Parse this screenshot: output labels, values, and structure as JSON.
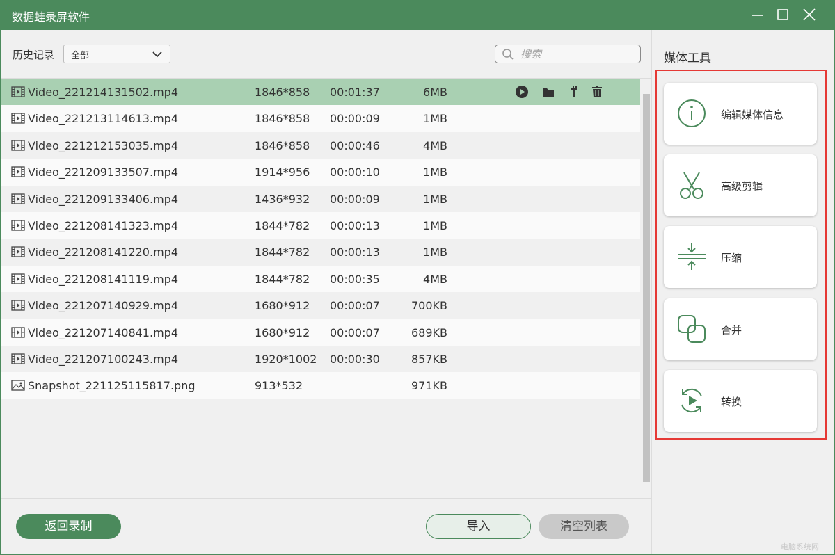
{
  "app": {
    "title": "数据蛙录屏软件"
  },
  "colors": {
    "brand": "#4b8a5c",
    "selected_row": "#a9d0b2",
    "highlight_border": "#e53935"
  },
  "toolbar": {
    "history_label": "历史记录",
    "filter_value": "全部",
    "search_placeholder": "搜索"
  },
  "files": [
    {
      "name": "Video_221214131502.mp4",
      "resolution": "1846*858",
      "duration": "00:01:37",
      "size": "6MB",
      "type": "video",
      "selected": true
    },
    {
      "name": "Video_221213114613.mp4",
      "resolution": "1846*858",
      "duration": "00:00:09",
      "size": "1MB",
      "type": "video"
    },
    {
      "name": "Video_221212153035.mp4",
      "resolution": "1846*858",
      "duration": "00:00:46",
      "size": "4MB",
      "type": "video"
    },
    {
      "name": "Video_221209133507.mp4",
      "resolution": "1914*956",
      "duration": "00:00:10",
      "size": "1MB",
      "type": "video"
    },
    {
      "name": "Video_221209133406.mp4",
      "resolution": "1436*932",
      "duration": "00:00:09",
      "size": "1MB",
      "type": "video"
    },
    {
      "name": "Video_221208141323.mp4",
      "resolution": "1844*782",
      "duration": "00:00:13",
      "size": "1MB",
      "type": "video"
    },
    {
      "name": "Video_221208141220.mp4",
      "resolution": "1844*782",
      "duration": "00:00:13",
      "size": "1MB",
      "type": "video"
    },
    {
      "name": "Video_221208141119.mp4",
      "resolution": "1844*782",
      "duration": "00:00:35",
      "size": "4MB",
      "type": "video"
    },
    {
      "name": "Video_221207140929.mp4",
      "resolution": "1680*912",
      "duration": "00:00:07",
      "size": "700KB",
      "type": "video"
    },
    {
      "name": "Video_221207140841.mp4",
      "resolution": "1680*912",
      "duration": "00:00:07",
      "size": "689KB",
      "type": "video"
    },
    {
      "name": "Video_221207100243.mp4",
      "resolution": "1920*1002",
      "duration": "00:00:30",
      "size": "857KB",
      "type": "video"
    },
    {
      "name": "Snapshot_221125115817.png",
      "resolution": "913*532",
      "duration": "",
      "size": "971KB",
      "type": "image"
    }
  ],
  "row_actions": [
    "play-icon",
    "folder-icon",
    "wrench-icon",
    "trash-icon"
  ],
  "media_tools": {
    "title": "媒体工具",
    "items": [
      {
        "label": "编辑媒体信息",
        "icon": "info-icon"
      },
      {
        "label": "高级剪辑",
        "icon": "scissors-icon"
      },
      {
        "label": "压缩",
        "icon": "compress-icon"
      },
      {
        "label": "合并",
        "icon": "merge-icon"
      },
      {
        "label": "转换",
        "icon": "convert-icon"
      }
    ]
  },
  "buttons": {
    "back": "返回录制",
    "import": "导入",
    "clear": "清空列表"
  },
  "watermark": "电脑系统网"
}
